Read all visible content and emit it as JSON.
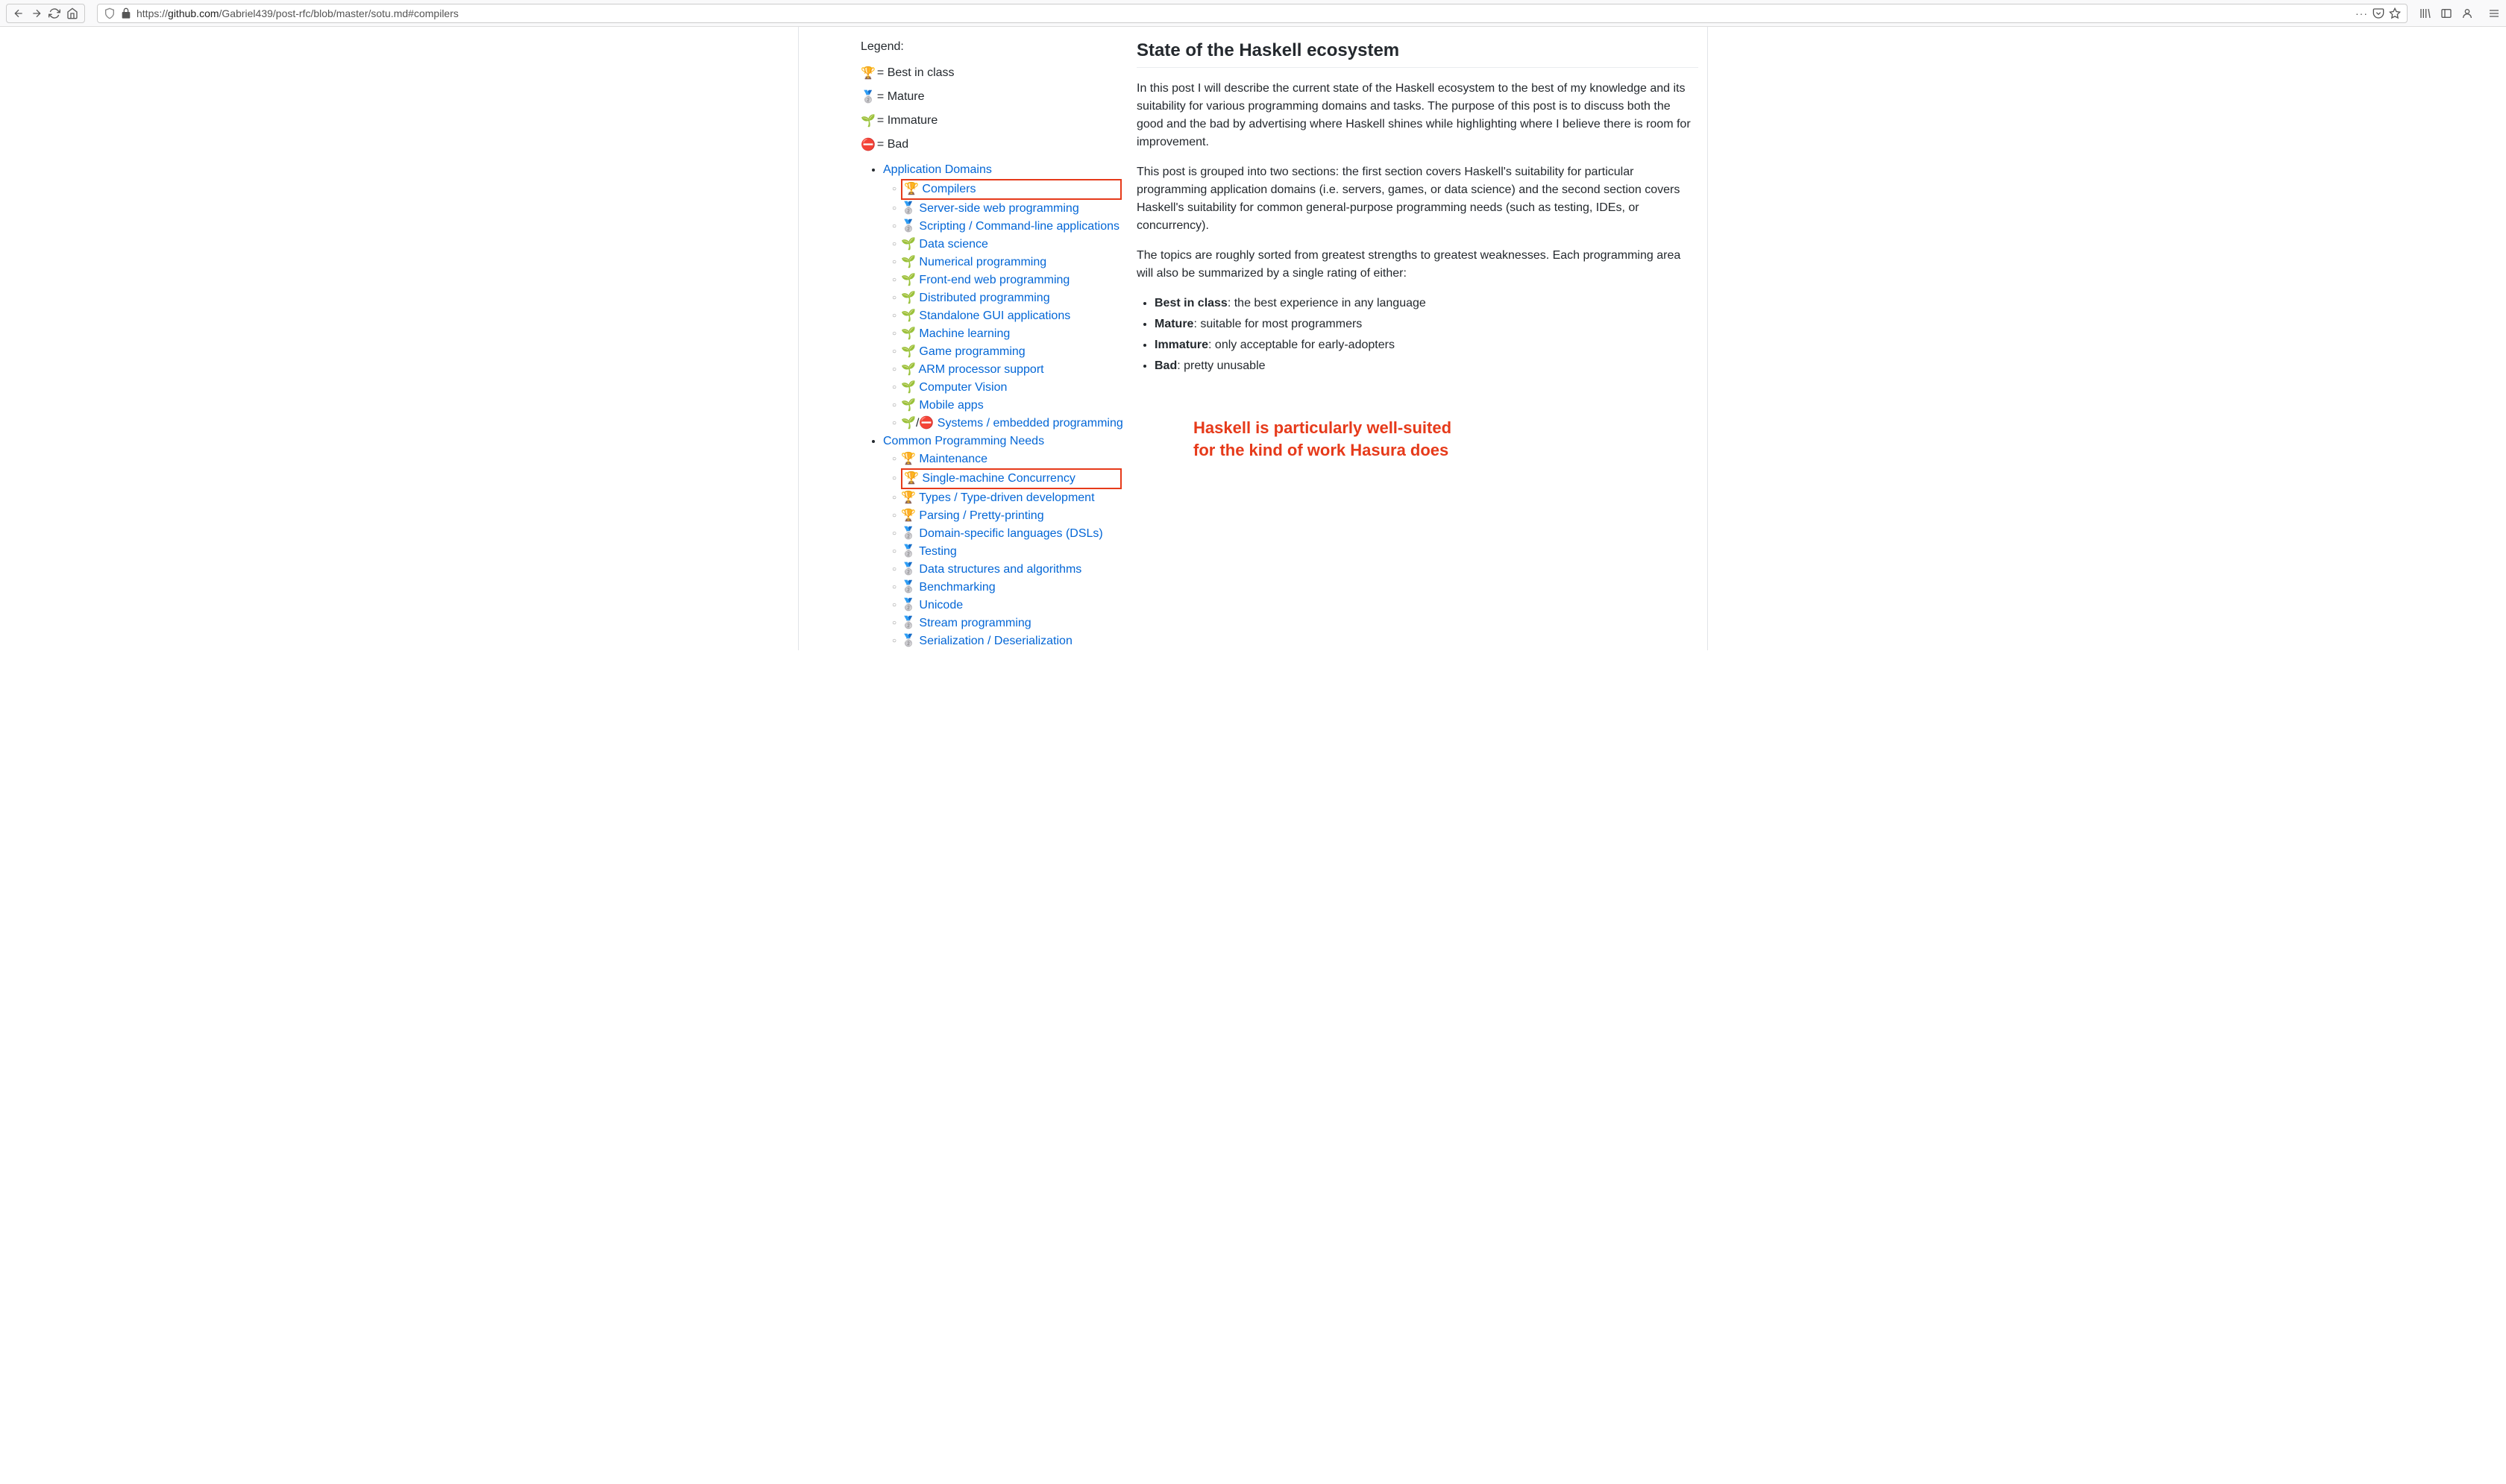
{
  "browser": {
    "url_prefix": "https://",
    "url_domain": "github.com",
    "url_path": "/Gabriel439/post-rfc/blob/master/sotu.md#compilers"
  },
  "legend": {
    "title": "Legend:",
    "items": [
      {
        "icon": "🏆",
        "label": " = Best in class"
      },
      {
        "icon": "🥈",
        "label": " = Mature"
      },
      {
        "icon": "🌱",
        "label": " = Immature"
      },
      {
        "icon": "⛔",
        "label": " = Bad"
      }
    ]
  },
  "toc": {
    "section1": {
      "title": "Application Domains",
      "items": [
        {
          "icon": "🏆",
          "label": "Compilers",
          "highlight": true
        },
        {
          "icon": "🥈",
          "label": "Server-side web programming"
        },
        {
          "icon": "🥈",
          "label": "Scripting / Command-line applications"
        },
        {
          "icon": "🌱",
          "label": "Data science"
        },
        {
          "icon": "🌱",
          "label": "Numerical programming"
        },
        {
          "icon": "🌱",
          "label": "Front-end web programming"
        },
        {
          "icon": "🌱",
          "label": "Distributed programming"
        },
        {
          "icon": "🌱",
          "label": "Standalone GUI applications"
        },
        {
          "icon": "🌱",
          "label": "Machine learning"
        },
        {
          "icon": "🌱",
          "label": "Game programming"
        },
        {
          "icon": "🌱",
          "label": "ARM processor support"
        },
        {
          "icon": "🌱",
          "label": "Computer Vision"
        },
        {
          "icon": "🌱",
          "label": "Mobile apps"
        },
        {
          "icon": "🌱/⛔",
          "label": "Systems / embedded programming"
        }
      ]
    },
    "section2": {
      "title": "Common Programming Needs",
      "items": [
        {
          "icon": "🏆",
          "label": "Maintenance"
        },
        {
          "icon": "🏆",
          "label": "Single-machine Concurrency",
          "highlight": true
        },
        {
          "icon": "🏆",
          "label": "Types / Type-driven development"
        },
        {
          "icon": "🏆",
          "label": "Parsing / Pretty-printing"
        },
        {
          "icon": "🥈",
          "label": "Domain-specific languages (DSLs)"
        },
        {
          "icon": "🥈",
          "label": "Testing"
        },
        {
          "icon": "🥈",
          "label": "Data structures and algorithms"
        },
        {
          "icon": "🥈",
          "label": "Benchmarking"
        },
        {
          "icon": "🥈",
          "label": "Unicode"
        },
        {
          "icon": "🥈",
          "label": "Stream programming"
        },
        {
          "icon": "🥈",
          "label": "Serialization / Deserialization"
        }
      ]
    }
  },
  "article": {
    "title": "State of the Haskell ecosystem",
    "p1": "In this post I will describe the current state of the Haskell ecosystem to the best of my knowledge and its suitability for various programming domains and tasks. The purpose of this post is to discuss both the good and the bad by advertising where Haskell shines while highlighting where I believe there is room for improvement.",
    "p2": "This post is grouped into two sections: the first section covers Haskell's suitability for particular programming application domains (i.e. servers, games, or data science) and the second section covers Haskell's suitability for common general-purpose programming needs (such as testing, IDEs, or concurrency).",
    "p3": "The topics are roughly sorted from greatest strengths to greatest weaknesses. Each programming area will also be summarized by a single rating of either:",
    "ratings": [
      {
        "strong": "Best in class",
        "rest": ": the best experience in any language"
      },
      {
        "strong": "Mature",
        "rest": ": suitable for most programmers"
      },
      {
        "strong": "Immature",
        "rest": ": only acceptable for early-adopters"
      },
      {
        "strong": "Bad",
        "rest": ": pretty unusable"
      }
    ],
    "callout_l1": "Haskell is particularly well-suited",
    "callout_l2": "for the kind of work Hasura does"
  }
}
